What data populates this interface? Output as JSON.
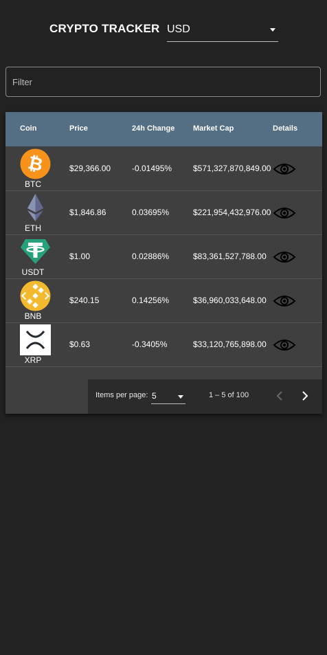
{
  "header": {
    "title": "CRYPTO TRACKER",
    "currency": "USD"
  },
  "filter": {
    "placeholder": "Filter"
  },
  "table": {
    "columns": [
      "Coin",
      "Price",
      "24h Change",
      "Market Cap",
      "Details"
    ],
    "rows": [
      {
        "symbol": "BTC",
        "price": "$29,366.00",
        "change": "-0.01495%",
        "market_cap": "$571,327,870,849.00",
        "logo": "bitcoin-logo"
      },
      {
        "symbol": "ETH",
        "price": "$1,846.86",
        "change": "0.03695%",
        "market_cap": "$221,954,432,976.00",
        "logo": "ethereum-logo"
      },
      {
        "symbol": "USDT",
        "price": "$1.00",
        "change": "0.02886%",
        "market_cap": "$83,361,527,788.00",
        "logo": "tether-logo"
      },
      {
        "symbol": "BNB",
        "price": "$240.15",
        "change": "0.14256%",
        "market_cap": "$36,960,033,648.00",
        "logo": "bnb-logo"
      },
      {
        "symbol": "XRP",
        "price": "$0.63",
        "change": "-0.3405%",
        "market_cap": "$33,120,765,898.00",
        "logo": "xrp-logo"
      }
    ]
  },
  "paginator": {
    "items_per_page_label": "Items per page:",
    "page_size": "5",
    "range": "1 – 5 of 100"
  },
  "colors": {
    "background": "#222222",
    "table_header": "#546e83",
    "row_background": "#3f3f3f",
    "bitcoin": "#f7931a",
    "tether": "#26a17b",
    "bnb": "#f3ba2f"
  }
}
